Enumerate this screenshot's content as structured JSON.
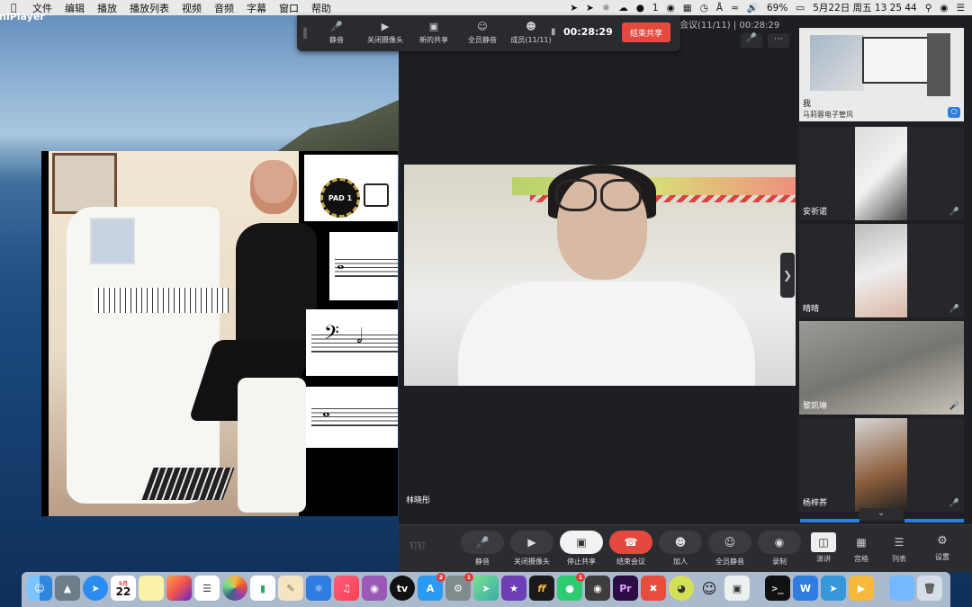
{
  "menubar": {
    "app_name": "OmniPlayer",
    "items": [
      "文件",
      "编辑",
      "播放",
      "播放列表",
      "视频",
      "音频",
      "字幕",
      "窗口",
      "帮助"
    ],
    "status": {
      "bell": "1",
      "battery": "69%",
      "datetime": "5月22日 周五  13 25 44"
    }
  },
  "toolbar": {
    "buttons": [
      {
        "label": "静音",
        "icon": "microphone-icon"
      },
      {
        "label": "关闭摄像头",
        "icon": "camera-icon"
      },
      {
        "label": "新的共享",
        "icon": "share-screen-icon"
      },
      {
        "label": "全员静音",
        "icon": "mute-all-icon"
      },
      {
        "label": "成员(11/11)",
        "icon": "members-icon"
      }
    ],
    "timer": "00:28:29",
    "end_share": "结束共享"
  },
  "meeting": {
    "title_fragment": "会议(11/11)  |  00:28:29",
    "main_speaker": "林晓彤",
    "participants": [
      {
        "name": "我",
        "subtitle": "马莉蓉电子管风"
      },
      {
        "name": "安祈诺"
      },
      {
        "name": "晴晴"
      },
      {
        "name": "黎凯琳"
      },
      {
        "name": "杨梓荞"
      }
    ],
    "controls": {
      "brand": "钉钉",
      "buttons": [
        {
          "label": "静音",
          "icon": "microphone-icon"
        },
        {
          "label": "关闭摄像头",
          "icon": "camera-icon"
        },
        {
          "label": "停止共享",
          "icon": "stop-share-icon"
        },
        {
          "label": "结束会议",
          "icon": "hang-up-icon"
        },
        {
          "label": "加人",
          "icon": "add-person-icon"
        },
        {
          "label": "全员静音",
          "icon": "mute-all-icon"
        },
        {
          "label": "录制",
          "icon": "record-icon"
        }
      ],
      "layouts": [
        {
          "label": "演讲",
          "selected": true
        },
        {
          "label": "宫格",
          "selected": false
        },
        {
          "label": "列表",
          "selected": false
        }
      ],
      "settings": "设置"
    }
  },
  "sheet_music": {
    "pad_label": "PAD 1"
  },
  "dock": {
    "apps": [
      "Finder",
      "Launchpad",
      "Safari",
      "Calendar",
      "Notes",
      "Pages",
      "Reminders",
      "Photos",
      "Numbers",
      "Keynote",
      "Preview",
      "Music",
      "Podcasts",
      "TV",
      "App Store",
      "System Preferences",
      "Maps",
      "iMovie",
      "Final Draft",
      "WeChat",
      "QuickTime",
      "Premiere Pro",
      "XMind",
      "Mindjet",
      "QQ",
      "Screenshot",
      "Terminal",
      "WPS",
      "Lark",
      "Keynote Viewer",
      "Folder",
      "Trash"
    ],
    "calendar_day": "22",
    "calendar_month": "5月",
    "badges": {
      "appstore": "2",
      "sysprefs": "1",
      "wechat": "1"
    }
  }
}
